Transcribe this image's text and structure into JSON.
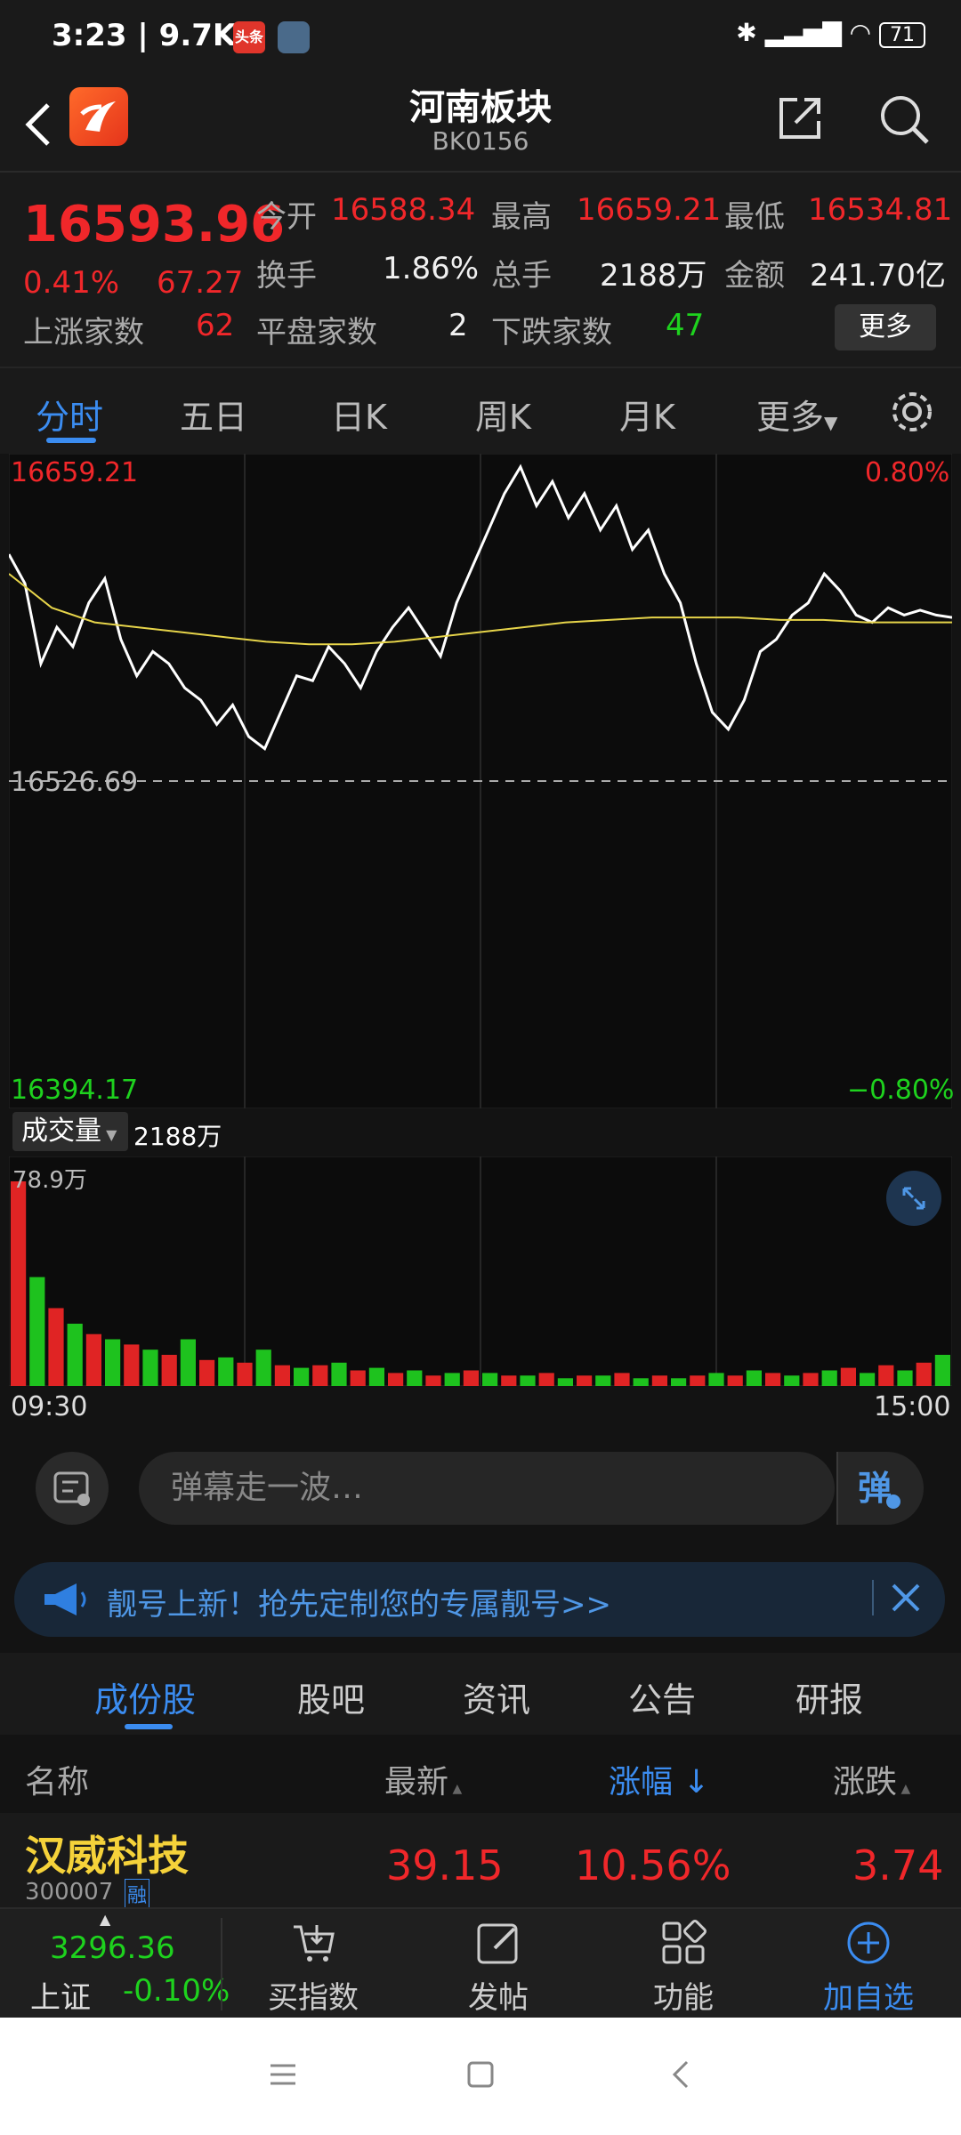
{
  "status": {
    "time": "3:23 | 9.7K/s",
    "app_badge": "头条",
    "battery": "71"
  },
  "header": {
    "title": "河南板块",
    "code": "BK0156"
  },
  "quote": {
    "price": "16593.96",
    "pct": "0.41%",
    "chg": "67.27",
    "open_label": "今开",
    "open": "16588.34",
    "high_label": "最高",
    "high": "16659.21",
    "low_label": "最低",
    "low": "16534.81",
    "turnover_label": "换手",
    "turnover": "1.86%",
    "volume_label": "总手",
    "volume": "2188万",
    "amount_label": "金额",
    "amount": "241.70亿",
    "up_label": "上涨家数",
    "up": "62",
    "flat_label": "平盘家数",
    "flat": "2",
    "down_label": "下跌家数",
    "down": "47",
    "more": "更多"
  },
  "tabs": [
    "分时",
    "五日",
    "日K",
    "周K",
    "月K",
    "更多"
  ],
  "chart": {
    "high_label": "16659.21",
    "high_pct": "0.80%",
    "mid_label": "16526.69",
    "low_label": "16394.17",
    "low_pct": "−0.80%",
    "vol_selector": "成交量",
    "vol_total": "2188万",
    "vol_max": "78.9万",
    "t_start": "09:30",
    "t_end": "15:00"
  },
  "chart_data": {
    "type": "line",
    "ylim": [
      16394.17,
      16659.21
    ],
    "prev_close": 16526.69,
    "series": [
      {
        "values": [
          16620,
          16608,
          16575,
          16590,
          16582,
          16600,
          16610,
          16585,
          16570,
          16580,
          16575,
          16565,
          16560,
          16550,
          16558,
          16545,
          16540,
          16555,
          16570,
          16568,
          16582,
          16575,
          16565,
          16580,
          16590,
          16598,
          16588,
          16578,
          16600,
          16615,
          16630,
          16645,
          16656,
          16640,
          16650,
          16635,
          16645,
          16630,
          16640,
          16622,
          16630,
          16612,
          16600,
          16575,
          16555,
          16548,
          16560,
          16580,
          16585,
          16595,
          16600,
          16612,
          16605,
          16595,
          16592,
          16598,
          16595,
          16597,
          16595,
          16594
        ]
      },
      {
        "values": [
          16612,
          16598,
          16592,
          16590,
          16588,
          16586,
          16584,
          16583,
          16583,
          16584,
          16586,
          16588,
          16590,
          16592,
          16593,
          16594,
          16594,
          16594,
          16593,
          16593,
          16592,
          16592,
          16592
        ]
      }
    ],
    "volume": [
      78.9,
      42,
      30,
      24,
      20,
      18,
      16,
      14,
      12,
      18,
      10,
      11,
      9,
      14,
      8,
      7,
      8,
      9,
      6,
      7,
      5,
      6,
      4,
      5,
      6,
      5,
      4,
      4,
      5,
      3,
      4,
      4,
      5,
      3,
      4,
      3,
      4,
      5,
      4,
      6,
      5,
      4,
      5,
      6,
      7,
      5,
      8,
      6,
      9,
      12
    ]
  },
  "danmaku": {
    "placeholder": "弹幕走一波…"
  },
  "banner": {
    "text": "靓号上新！抢先定制您的专属靓号>>"
  },
  "list_tabs": [
    "成份股",
    "股吧",
    "资讯",
    "公告",
    "研报"
  ],
  "table": {
    "headers": {
      "name": "名称",
      "latest": "最新",
      "pct": "涨幅",
      "chg": "涨跌"
    },
    "rows": [
      {
        "name": "汉威科技",
        "code": "300007",
        "tag": "融",
        "latest": "39.15",
        "pct": "10.56%",
        "chg": "3.74"
      }
    ]
  },
  "bottom_nav": {
    "index_value": "3296.36",
    "index_name": "上证",
    "index_pct": "-0.10%",
    "items": [
      "买指数",
      "发帖",
      "功能",
      "加自选"
    ]
  }
}
